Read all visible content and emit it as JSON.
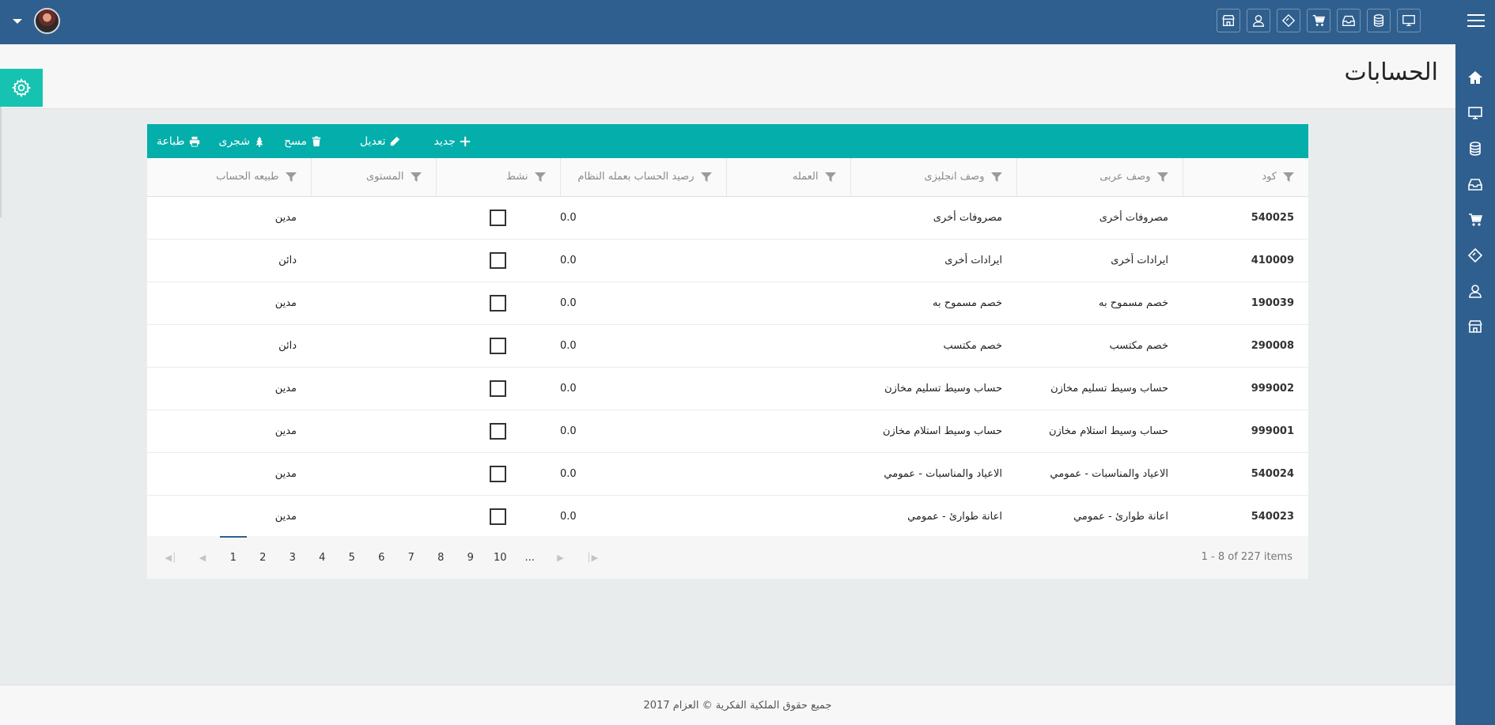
{
  "page": {
    "title": "الحسابات"
  },
  "toolbar": {
    "new_label": "جديد",
    "edit_label": "تعديل",
    "delete_label": "مسح",
    "tree_label": "شجرى",
    "print_label": "طباعة"
  },
  "columns": {
    "code": "كود",
    "arabic_desc": "وصف عربى",
    "english_desc": "وصف انجليزى",
    "currency": "العمله",
    "balance": "رصيد الحساب بعمله النظام",
    "active": "نشط",
    "level": "المستوى",
    "account_type": "طبيعه الحساب"
  },
  "rows": [
    {
      "code": "540025",
      "arabic_desc": "مصروفات أخرى",
      "english_desc": "مصروفات أخرى",
      "currency": "",
      "balance": "0.0",
      "level": "",
      "account_type": "مدين"
    },
    {
      "code": "410009",
      "arabic_desc": "ايرادات أخرى",
      "english_desc": "ايرادات أخرى",
      "currency": "",
      "balance": "0.0",
      "level": "",
      "account_type": "دائن"
    },
    {
      "code": "190039",
      "arabic_desc": "خصم مسموح به",
      "english_desc": "خصم مسموح به",
      "currency": "",
      "balance": "0.0",
      "level": "",
      "account_type": "مدين"
    },
    {
      "code": "290008",
      "arabic_desc": "خصم مكتسب",
      "english_desc": "خصم مكتسب",
      "currency": "",
      "balance": "0.0",
      "level": "",
      "account_type": "دائن"
    },
    {
      "code": "999002",
      "arabic_desc": "حساب وسيط تسليم مخازن",
      "english_desc": "حساب وسيط تسليم مخازن",
      "currency": "",
      "balance": "0.0",
      "level": "",
      "account_type": "مدين"
    },
    {
      "code": "999001",
      "arabic_desc": "حساب وسيط استلام مخازن",
      "english_desc": "حساب وسيط استلام مخازن",
      "currency": "",
      "balance": "0.0",
      "level": "",
      "account_type": "مدين"
    },
    {
      "code": "540024",
      "arabic_desc": "الاعياد والمناسبات - عمومي",
      "english_desc": "الاعياد والمناسبات - عمومي",
      "currency": "",
      "balance": "0.0",
      "level": "",
      "account_type": "مدين"
    },
    {
      "code": "540023",
      "arabic_desc": "اعانة طوارئ - عمومي",
      "english_desc": "اعانة طوارئ - عمومي",
      "currency": "",
      "balance": "0.0",
      "level": "",
      "account_type": "مدين"
    }
  ],
  "pager": {
    "pages": [
      "1",
      "2",
      "3",
      "4",
      "5",
      "6",
      "7",
      "8",
      "9",
      "10",
      "..."
    ],
    "current_page": "1",
    "info": "1 - 8 of 227 items"
  },
  "footer": {
    "text": "جميع حقوق الملكية الفكرية © العزام 2017"
  },
  "colors": {
    "header": "#2f5f8e",
    "accent": "#03aeab",
    "settings": "#16c3b0"
  },
  "icons": {
    "topbar": [
      "monitor-icon",
      "database-icon",
      "inbox-icon",
      "cart-icon",
      "ticket-icon",
      "user-icon",
      "store-icon"
    ],
    "sidebar": [
      "home-icon",
      "monitor-icon",
      "database-icon",
      "inbox-icon",
      "cart-icon",
      "ticket-icon",
      "user-icon",
      "store-icon"
    ]
  }
}
